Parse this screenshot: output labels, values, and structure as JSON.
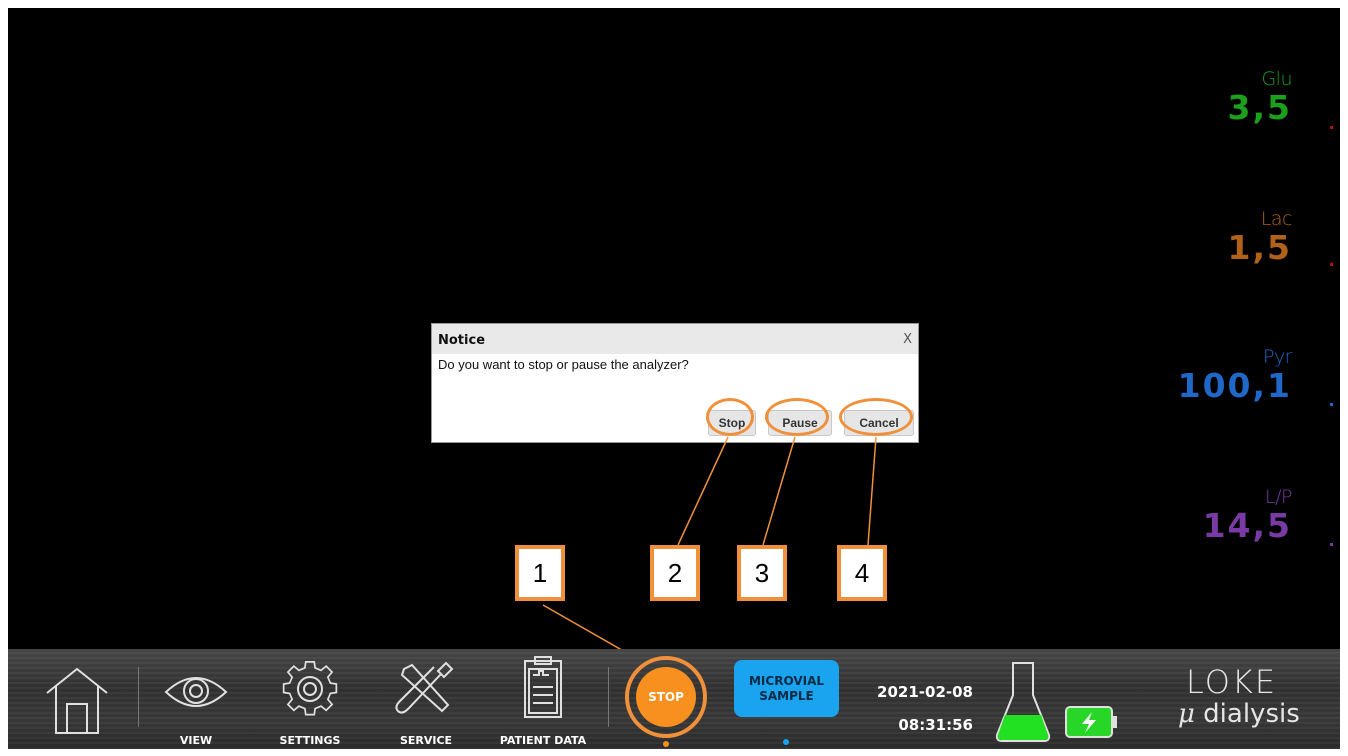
{
  "metrics": [
    {
      "label": "Glu",
      "value": "3,5",
      "color": "#1aa01a"
    },
    {
      "label": "Lac",
      "value": "1,5",
      "color": "#b0621a"
    },
    {
      "label": "Pyr",
      "value": "100,1",
      "color": "#1f68c8"
    },
    {
      "label": "L/P",
      "value": "14,5",
      "color": "#7a3aa6"
    }
  ],
  "dialog": {
    "title": "Notice",
    "close_label": "X",
    "message": "Do you want to stop or pause the analyzer?",
    "buttons": {
      "stop": "Stop",
      "pause": "Pause",
      "cancel": "Cancel"
    }
  },
  "callouts": [
    "1",
    "2",
    "3",
    "4"
  ],
  "toolbar": {
    "home": {
      "icon": "home-icon"
    },
    "view": {
      "label": "VIEW",
      "icon": "eye-icon"
    },
    "settings": {
      "label": "SETTINGS",
      "icon": "gear-icon"
    },
    "service": {
      "label": "SERVICE",
      "icon": "tools-icon"
    },
    "patient_data": {
      "label": "PATIENT DATA",
      "icon": "clipboard-icon"
    },
    "stop": {
      "label": "STOP"
    },
    "microvial": {
      "line1": "MICROVIAL",
      "line2": "SAMPLE"
    },
    "date": "2021-02-08",
    "time": "08:31:56",
    "flask": {
      "icon": "flask-icon"
    },
    "battery": {
      "icon": "battery-charging-icon"
    },
    "logo": {
      "top": "LOKE",
      "mu": "μ",
      "bottom": "dialysis"
    }
  },
  "colors": {
    "accent_orange": "#f0903a",
    "stop_orange": "#f7901e",
    "microvial_blue": "#1aa3ee",
    "flask_green": "#22e022",
    "battery_green": "#28d628"
  }
}
